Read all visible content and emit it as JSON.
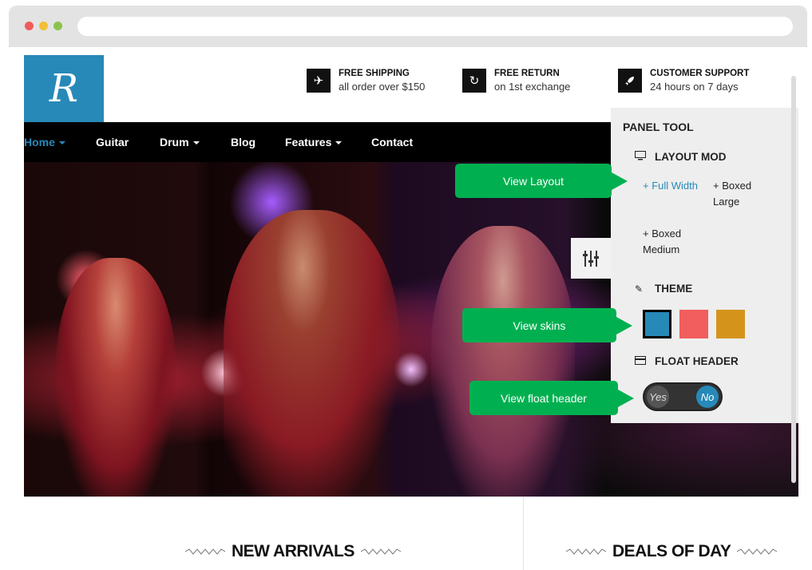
{
  "logo": {
    "letter": "R"
  },
  "features": [
    {
      "icon": "airplane-icon",
      "glyph": "✈",
      "title": "FREE SHIPPING",
      "subtitle": "all order over $150"
    },
    {
      "icon": "return-icon",
      "glyph": "↻",
      "title": "FREE RETURN",
      "subtitle": "on 1st exchange"
    },
    {
      "icon": "rocket-icon",
      "glyph": "🚀",
      "title": "CUSTOMER SUPPORT",
      "subtitle": "24 hours on 7 days"
    }
  ],
  "nav": {
    "items": [
      {
        "label": "Home",
        "dropdown": true,
        "active": true
      },
      {
        "label": "Guitar",
        "dropdown": false
      },
      {
        "label": "Drum",
        "dropdown": true
      },
      {
        "label": "Blog",
        "dropdown": false
      },
      {
        "label": "Features",
        "dropdown": true
      },
      {
        "label": "Contact",
        "dropdown": false
      }
    ]
  },
  "panel": {
    "title": "PANEL TOOL",
    "layout_heading": "LAYOUT MOD",
    "layout_options": [
      "+ Full Width",
      "+ Boxed Large",
      "+ Boxed Medium"
    ],
    "theme_heading": "THEME",
    "skins": [
      "#2789b8",
      "#f25d5d",
      "#d4941c"
    ],
    "float_heading": "FLOAT HEADER",
    "toggle_yes": "Yes",
    "toggle_no": "No"
  },
  "callouts": {
    "view_layout": "View Layout",
    "view_skins": "View skins",
    "view_float_header": "View float header"
  },
  "sections": {
    "new_arrivals": "NEW ARRIVALS",
    "deals_of_day": "DEALS OF DAY"
  },
  "colors": {
    "accent": "#2789b8",
    "callout_green": "#00b050"
  }
}
